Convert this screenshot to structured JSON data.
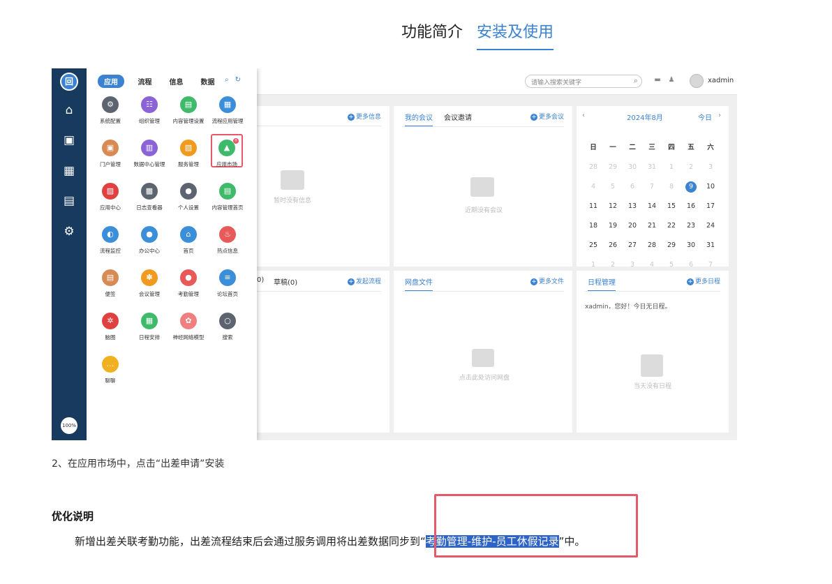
{
  "top_tabs": [
    {
      "label": "功能简介",
      "active": false
    },
    {
      "label": "安装及使用",
      "active": true
    }
  ],
  "shot": {
    "header": {
      "search_placeholder": "请输入搜索关键字",
      "user": "xadmin"
    },
    "rail": {
      "logo": "回",
      "zoom": "100%"
    },
    "menu": {
      "tabs": [
        "应用",
        "流程",
        "信息",
        "数据"
      ],
      "apps": [
        {
          "label": "系统配置",
          "color": "#5d6470",
          "glyph": "⚙"
        },
        {
          "label": "组织管理",
          "color": "#8b63d6",
          "glyph": "☷"
        },
        {
          "label": "内容管理设置",
          "color": "#3fba6b",
          "glyph": "▤"
        },
        {
          "label": "流程应用管理",
          "color": "#3b8ed8",
          "glyph": "▦"
        },
        {
          "label": "门户管理",
          "color": "#d88a54",
          "glyph": "▣"
        },
        {
          "label": "数据中心管理",
          "color": "#8b63d6",
          "glyph": "▥"
        },
        {
          "label": "服务管理",
          "color": "#f09a20",
          "glyph": "▧"
        },
        {
          "label": "应用市场",
          "color": "#3fba6b",
          "glyph": "▲"
        },
        {
          "label": "应用中心",
          "color": "#e04040",
          "glyph": "▨"
        },
        {
          "label": "日志查看器",
          "color": "#5d6470",
          "glyph": "▩"
        },
        {
          "label": "个人设置",
          "color": "#5d6470",
          "glyph": "●"
        },
        {
          "label": "内容管理首页",
          "color": "#3fba6b",
          "glyph": "▤"
        },
        {
          "label": "流程监控",
          "color": "#3b8ed8",
          "glyph": "◐"
        },
        {
          "label": "办公中心",
          "color": "#3b8ed8",
          "glyph": "●"
        },
        {
          "label": "首页",
          "color": "#3b8ed8",
          "glyph": "⌂"
        },
        {
          "label": "热点信息",
          "color": "#e85a5a",
          "glyph": "♨"
        },
        {
          "label": "便签",
          "color": "#d88a54",
          "glyph": "▤"
        },
        {
          "label": "会议管理",
          "color": "#f09a20",
          "glyph": "✽"
        },
        {
          "label": "考勤管理",
          "color": "#e85a5a",
          "glyph": "●"
        },
        {
          "label": "论坛首页",
          "color": "#3b8ed8",
          "glyph": "≡"
        },
        {
          "label": "脑图",
          "color": "#e04040",
          "glyph": "✲"
        },
        {
          "label": "日程安排",
          "color": "#3fba6b",
          "glyph": "▦"
        },
        {
          "label": "神经网络模型",
          "color": "#f08080",
          "glyph": "✿"
        },
        {
          "label": "搜索",
          "color": "#5d6470",
          "glyph": "○"
        },
        {
          "label": "聊聊",
          "color": "#f0b020",
          "glyph": "…"
        }
      ],
      "badge": "+"
    },
    "panels": {
      "info": {
        "more": "更多信息",
        "empty": "暂时没有信息"
      },
      "meeting": {
        "tab1": "我的会议",
        "tab2": "会议邀请",
        "more": "更多会议",
        "empty": "近期没有会议"
      },
      "flow": {
        "tab1": "0)",
        "tab2": "草稿(0)",
        "more": "发起流程"
      },
      "disk": {
        "title": "网盘文件",
        "more": "更多文件",
        "empty": "点击此处访问网盘"
      },
      "schedule": {
        "title": "日程管理",
        "more": "更多日程",
        "greeting": "xadmin，您好！今日无日程。",
        "empty": "当天没有日程"
      }
    },
    "calendar": {
      "month": "2024年8月",
      "today_btn": "今日",
      "weekdays": [
        "日",
        "一",
        "二",
        "三",
        "四",
        "五",
        "六"
      ],
      "days": [
        {
          "d": "28",
          "dim": true
        },
        {
          "d": "29",
          "dim": true
        },
        {
          "d": "30",
          "dim": true
        },
        {
          "d": "31",
          "dim": true
        },
        {
          "d": "1",
          "dim": true
        },
        {
          "d": "2",
          "dim": true
        },
        {
          "d": "3",
          "dim": true
        },
        {
          "d": "4",
          "dim": true
        },
        {
          "d": "5",
          "dim": true
        },
        {
          "d": "6",
          "dim": true
        },
        {
          "d": "7",
          "dim": true
        },
        {
          "d": "8",
          "dim": true
        },
        {
          "d": "9",
          "today": true
        },
        {
          "d": "10"
        },
        {
          "d": "11"
        },
        {
          "d": "12"
        },
        {
          "d": "13"
        },
        {
          "d": "14"
        },
        {
          "d": "15"
        },
        {
          "d": "16"
        },
        {
          "d": "17"
        },
        {
          "d": "18"
        },
        {
          "d": "19"
        },
        {
          "d": "20"
        },
        {
          "d": "21"
        },
        {
          "d": "22"
        },
        {
          "d": "23"
        },
        {
          "d": "24"
        },
        {
          "d": "25"
        },
        {
          "d": "26"
        },
        {
          "d": "27"
        },
        {
          "d": "28"
        },
        {
          "d": "29"
        },
        {
          "d": "30"
        },
        {
          "d": "31"
        },
        {
          "d": "1",
          "dim": true
        },
        {
          "d": "2",
          "dim": true
        },
        {
          "d": "3",
          "dim": true
        },
        {
          "d": "4",
          "dim": true
        },
        {
          "d": "5",
          "dim": true
        },
        {
          "d": "6",
          "dim": true
        },
        {
          "d": "7",
          "dim": true
        }
      ]
    }
  },
  "step_text": "2、在应用市场中，点击“出差申请”安装",
  "opt": {
    "title": "优化说明",
    "body_before": "新增出差关联考勤功能，出差流程结束后会通过服务调用将出差数据同步到“",
    "body_highlight": "考勤管理-维护-员工休假记录",
    "body_after": "”中。"
  }
}
